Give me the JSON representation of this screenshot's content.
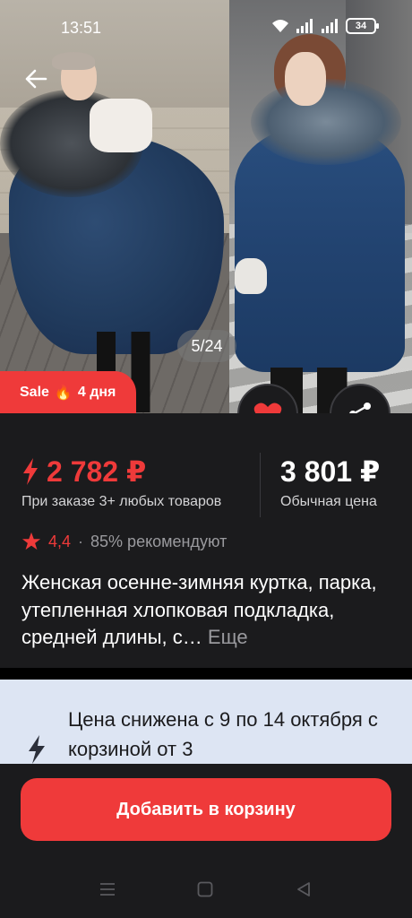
{
  "status_bar": {
    "time": "13:51",
    "battery": "34"
  },
  "gallery": {
    "counter": "5/24"
  },
  "sale_badge": {
    "label": "Sale",
    "fire_icon": "🔥",
    "days": "4 дня"
  },
  "price": {
    "sale_price": "2 782 ₽",
    "sale_note": "При заказе 3+ любых товаров",
    "regular_price": "3 801 ₽",
    "regular_note": "Обычная цена"
  },
  "rating": {
    "value": "4,4",
    "separator": "·",
    "recommend": "85% рекомендуют"
  },
  "product": {
    "title": "Женская осенне-зимняя куртка, парка, утепленная хлопковая подкладка, средней длины, с…",
    "more_label": "Еще"
  },
  "promo": {
    "text": "Цена снижена с 9 по 14 октября с корзиной от 3"
  },
  "actions": {
    "add_to_cart": "Добавить в корзину"
  },
  "colors": {
    "accent": "#ef3a3a",
    "background": "#1b1b1d",
    "promo_bg": "#dde5f3"
  },
  "icons": [
    "wifi-icon",
    "signal-icon",
    "battery-icon",
    "back-arrow-icon",
    "heart-icon",
    "share-icon",
    "bolt-icon",
    "star-icon",
    "menu-icon",
    "home-icon",
    "back-triangle-icon"
  ]
}
